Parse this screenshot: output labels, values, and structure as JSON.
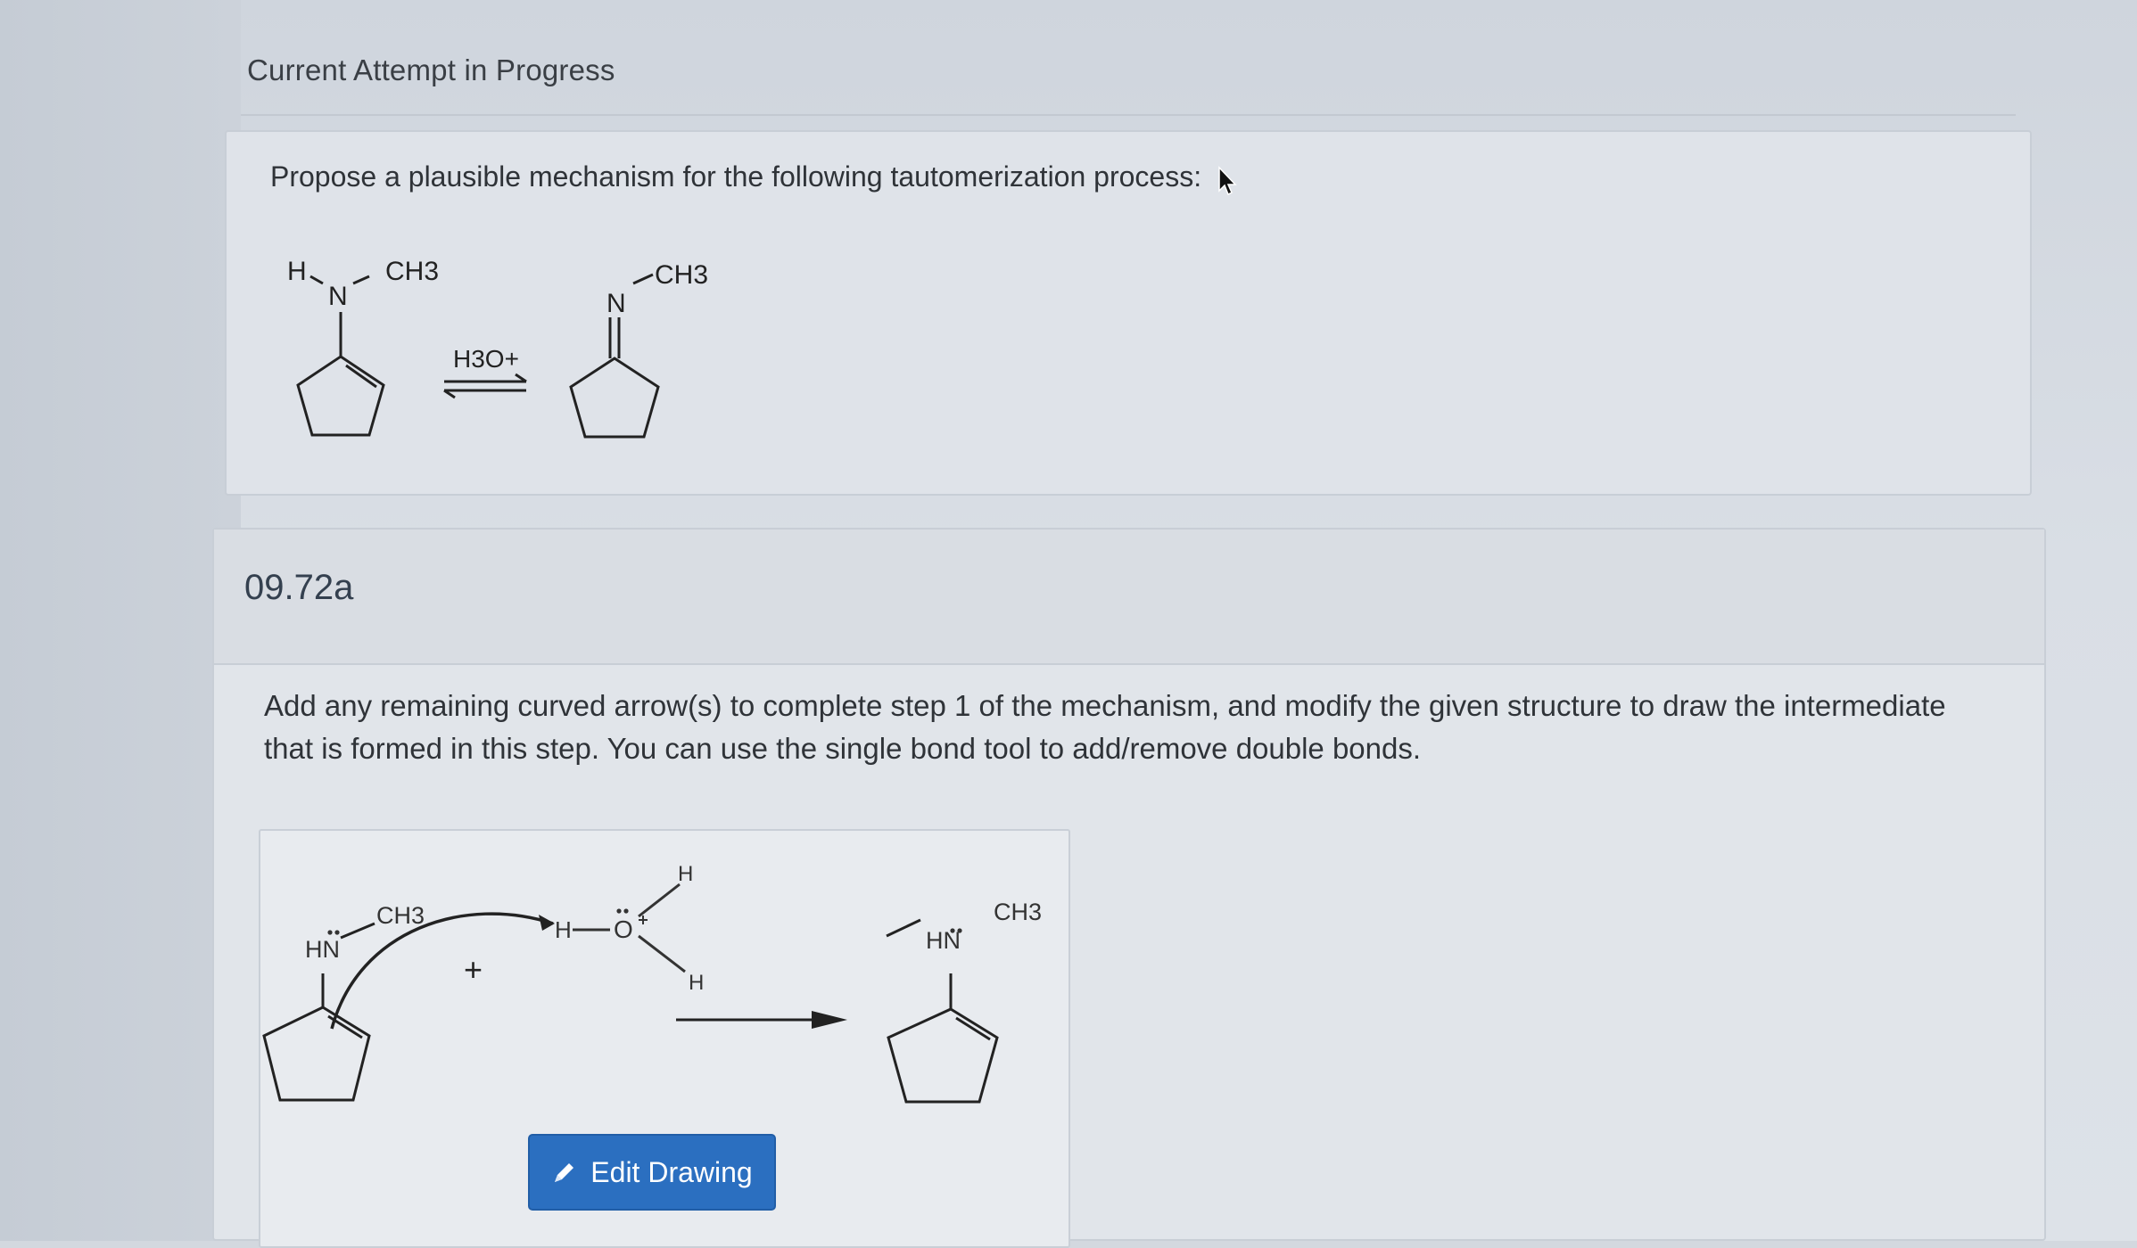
{
  "attempt": {
    "title": "Current Attempt in Progress"
  },
  "question": {
    "prompt": "Propose a plausible mechanism for the following tautomerization process:",
    "scheme": {
      "reactant_h": "H",
      "reactant_n": "N",
      "reactant_ch3": "CH3",
      "reagent": "H3O+",
      "product_n": "N",
      "product_ch3": "CH3"
    }
  },
  "part": {
    "id": "09.72a",
    "instructions": "Add any remaining curved arrow(s) to complete step 1 of the mechanism, and modify the given structure to draw the intermediate that is formed in this step. You can use the single bond tool to add/remove double bonds.",
    "drawing": {
      "left_hn": "HN",
      "left_ch3": "CH3",
      "plus": "+",
      "hydronium_h_left": "H",
      "hydronium_o": "O",
      "hydronium_h_top": "H",
      "hydronium_h_bottom": "H",
      "right_hn": "HN",
      "right_ch3": "CH3"
    },
    "edit_button_label": "Edit Drawing"
  },
  "colors": {
    "button": "#2b6fc0",
    "accent_text": "#34404f"
  }
}
